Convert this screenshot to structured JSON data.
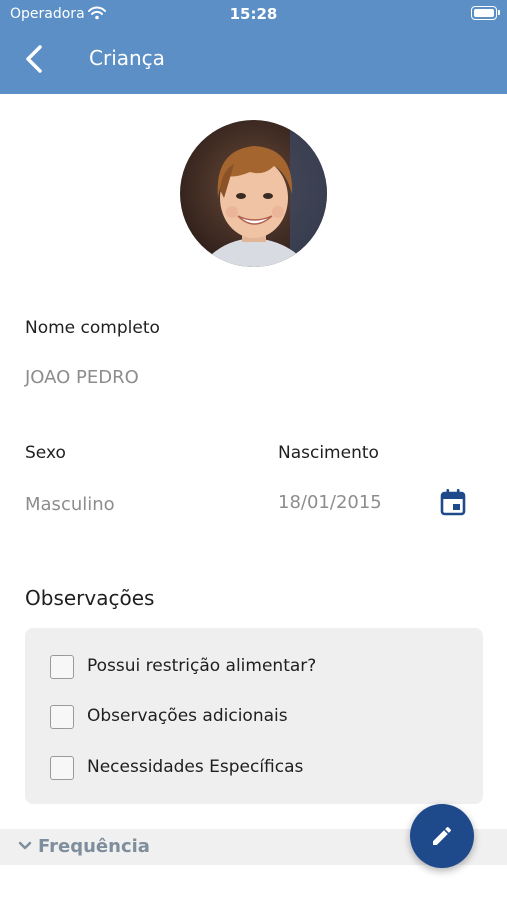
{
  "status_bar": {
    "carrier": "Operadora",
    "time": "15:28",
    "icons": [
      "wifi-icon",
      "battery-icon"
    ]
  },
  "header": {
    "title": "Criança",
    "back_icon": "chevron-left-icon"
  },
  "profile": {
    "avatar_alt": "child-photo"
  },
  "fields": {
    "name_label": "Nome completo",
    "name_value": "JOAO PEDRO",
    "sex_label": "Sexo",
    "sex_value": "Masculino",
    "birth_label": "Nascimento",
    "birth_value": "18/01/2015",
    "calendar_icon": "calendar-icon"
  },
  "observations": {
    "title": "Observações",
    "items": [
      {
        "label": "Possui restrição alimentar?",
        "checked": false
      },
      {
        "label": "Observações adicionais",
        "checked": false
      },
      {
        "label": "Necessidades Específicas",
        "checked": false
      }
    ]
  },
  "frequency": {
    "label": "Frequência",
    "icon": "chevron-down-icon"
  },
  "fab": {
    "icon": "pencil-icon"
  },
  "colors": {
    "header": "#5b8fc6",
    "fab": "#1e4a8c",
    "accent": "#1e4a8c"
  }
}
